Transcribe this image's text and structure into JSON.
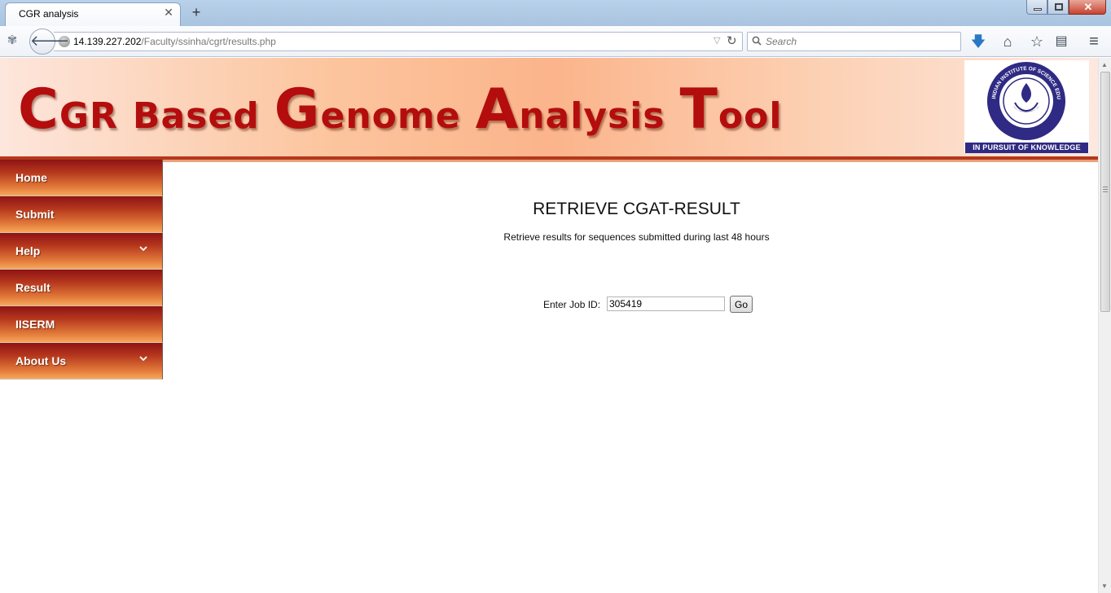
{
  "browser": {
    "tab_title": "CGR analysis",
    "tab_close": "✕",
    "new_tab": "+",
    "url_host": "14.139.227.202",
    "url_path": "/Faculty/ssinha/cgrt/results.php",
    "search_placeholder": "Search",
    "icons": [
      "extension-icon",
      "back-icon",
      "globe-icon",
      "dropdown-icon",
      "reload-icon",
      "search-icon",
      "download-icon",
      "home-icon",
      "bookmark-star-icon",
      "reading-list-icon",
      "menu-icon"
    ]
  },
  "banner": {
    "title_parts": [
      "C",
      "GR",
      "Based",
      "G",
      "enome",
      "A",
      "nalysis",
      "T",
      "ool"
    ],
    "logo_motto": "IN PURSUIT OF KNOWLEDGE",
    "logo_ring_text": "INDIAN INSTITUTE OF SCIENCE EDUCATION AND RESEARCH MOHALI"
  },
  "sidebar": {
    "items": [
      {
        "label": "Home",
        "has_submenu": false
      },
      {
        "label": "Submit",
        "has_submenu": false
      },
      {
        "label": "Help",
        "has_submenu": true
      },
      {
        "label": "Result",
        "has_submenu": false
      },
      {
        "label": "IISERM",
        "has_submenu": false
      },
      {
        "label": "About Us",
        "has_submenu": true
      }
    ]
  },
  "main": {
    "title": "RETRIEVE CGAT-RESULT",
    "subtitle": "Retrieve results for sequences submitted during last 48 hours",
    "job_label": "Enter Job ID:",
    "job_id_value": "305419",
    "go_label": "Go"
  },
  "colors": {
    "banner_text": "#b40d0d",
    "banner_rule": "#b4381b",
    "nav_top": "#8e1414",
    "nav_bottom": "#f6a75a",
    "logo_blue": "#2f2a83"
  }
}
